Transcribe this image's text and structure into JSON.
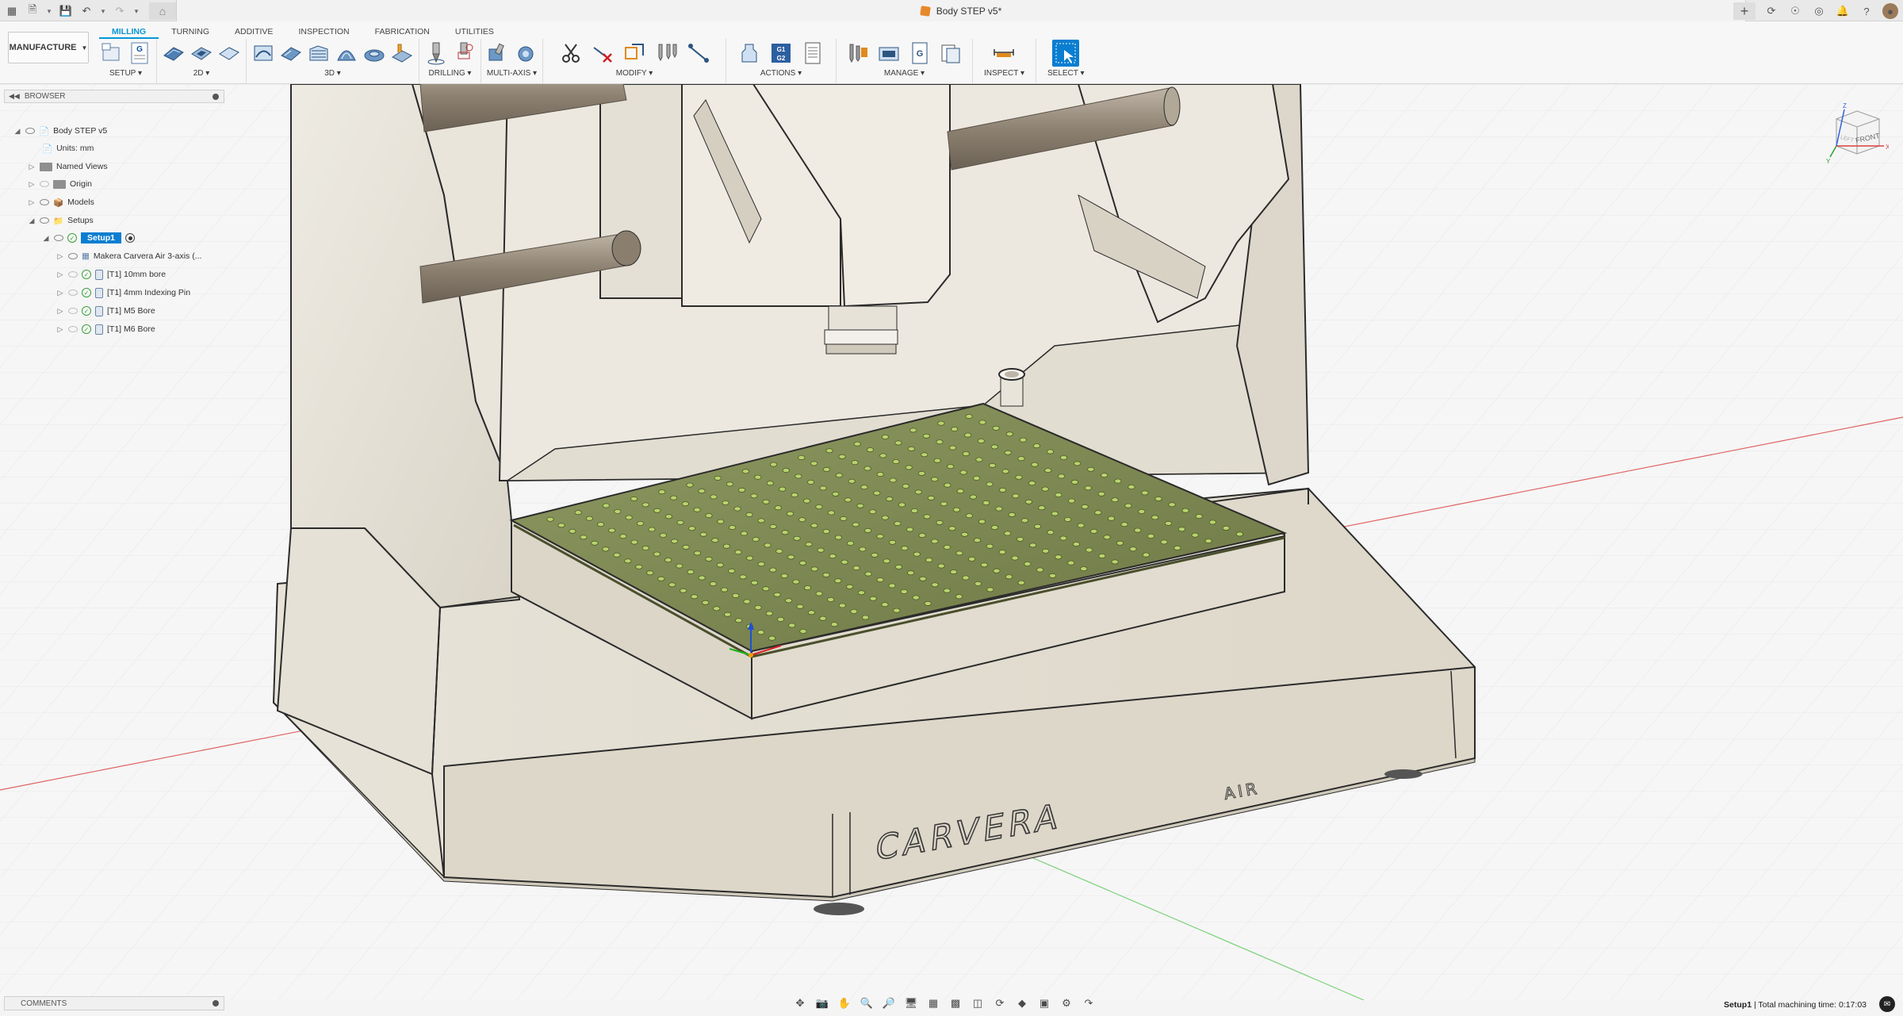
{
  "titlebar": {
    "document_title": "Body STEP v5*",
    "home_icon": "home-icon",
    "new_tab_label": "+"
  },
  "ribbon": {
    "workspace_label": "MANUFACTURE",
    "tabs": [
      {
        "label": "MILLING",
        "active": true
      },
      {
        "label": "TURNING",
        "active": false
      },
      {
        "label": "ADDITIVE",
        "active": false
      },
      {
        "label": "INSPECTION",
        "active": false
      },
      {
        "label": "FABRICATION",
        "active": false
      },
      {
        "label": "UTILITIES",
        "active": false
      }
    ],
    "groups": {
      "setup": "SETUP",
      "two_d": "2D",
      "three_d": "3D",
      "drilling": "DRILLING",
      "multi_axis": "MULTI-AXIS",
      "modify": "MODIFY",
      "actions": "ACTIONS",
      "manage": "MANAGE",
      "inspect": "INSPECT",
      "select": "SELECT"
    },
    "g_icon_text": "G",
    "g1g2_icon_text": "G1\nG2"
  },
  "browser": {
    "header": "BROWSER",
    "root": "Body STEP v5",
    "units": "Units: mm",
    "named_views": "Named Views",
    "origin": "Origin",
    "models": "Models",
    "setups": "Setups",
    "setup1": "Setup1",
    "machine": "Makera Carvera Air 3-axis (...",
    "ops": [
      "[T1] 10mm bore",
      "[T1] 4mm Indexing Pin",
      "[T1] M5 Bore",
      "[T1] M6 Bore"
    ]
  },
  "viewport": {
    "brand_text": "CARVERA",
    "brand_suffix": "AIR"
  },
  "viewcube": {
    "face_label": "FRONT",
    "left_label": "LEFT",
    "axis_x": "X",
    "axis_y": "Y",
    "axis_z": "Z"
  },
  "comments": {
    "header": "COMMENTS"
  },
  "status": {
    "setup_name": "Setup1",
    "machining_time": " | Total machining time: 0:17:03"
  },
  "colors": {
    "accent": "#0696d7",
    "selection": "#0a7ed1",
    "machine_body": "#e6e2d7",
    "bed": "#7f8a4f"
  }
}
